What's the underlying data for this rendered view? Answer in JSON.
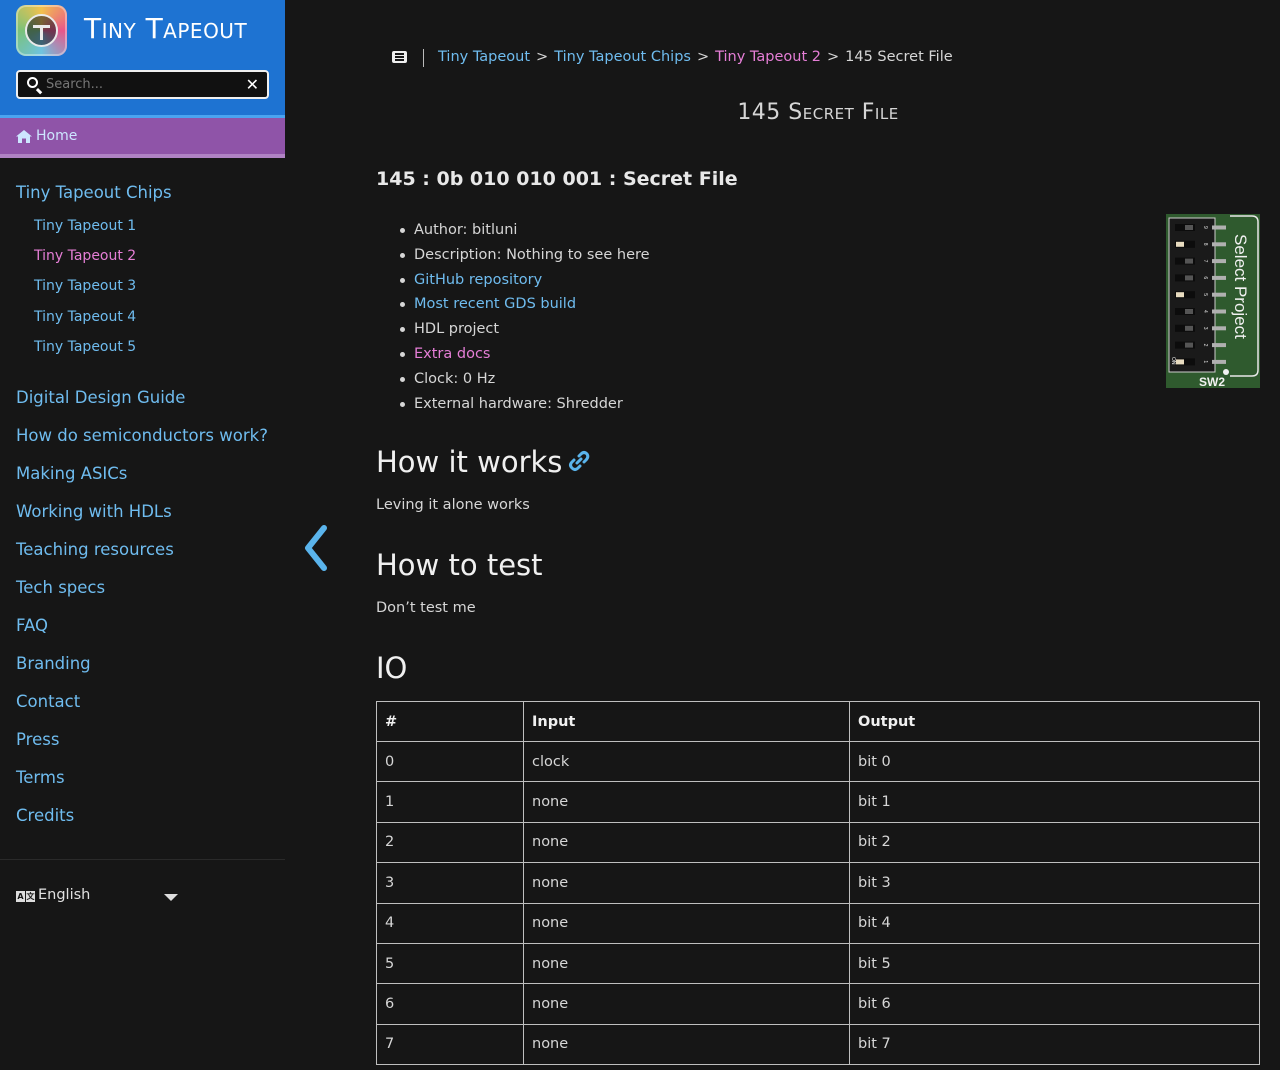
{
  "site": {
    "title": "Tiny Tapeout"
  },
  "search": {
    "placeholder": "Search..."
  },
  "sidebar": {
    "home": "Home",
    "chips_label": "Tiny Tapeout Chips",
    "chips": [
      "Tiny Tapeout 1",
      "Tiny Tapeout 2",
      "Tiny Tapeout 3",
      "Tiny Tapeout 4",
      "Tiny Tapeout 5"
    ],
    "active_chip": "Tiny Tapeout 2",
    "items": [
      "Digital Design Guide",
      "How do semiconductors work?",
      "Making ASICs",
      "Working with HDLs",
      "Teaching resources",
      "Tech specs",
      "FAQ",
      "Branding",
      "Contact",
      "Press",
      "Terms",
      "Credits"
    ],
    "language": "English",
    "language_icon_text": [
      "A",
      "文"
    ]
  },
  "breadcrumb": {
    "items": [
      "Tiny Tapeout",
      "Tiny Tapeout Chips",
      "Tiny Tapeout 2"
    ],
    "current": "145 Secret File",
    "separator": ">"
  },
  "page": {
    "title": "145 Secret File",
    "heading": "145 : 0b 010 010 001 : Secret File",
    "details": [
      "Author: bitluni",
      "Description: Nothing to see here",
      "GitHub repository",
      "Most recent GDS build",
      "HDL project",
      "Extra docs",
      "Clock: 0 Hz",
      "External hardware: Shredder"
    ],
    "how_it_works_title": "How it works",
    "how_it_works_text": "Leving it alone works",
    "how_to_test_title": "How to test",
    "how_to_test_text": "Don’t test me",
    "io_title": "IO"
  },
  "dip_switch": {
    "label": "Select Project",
    "switch_name": "SW2",
    "on_label": "ON",
    "numbers": [
      "9",
      "8",
      "7",
      "6",
      "5",
      "4",
      "3",
      "2",
      "1"
    ],
    "on_states": [
      false,
      true,
      false,
      false,
      true,
      false,
      false,
      false,
      true
    ]
  },
  "io_table": {
    "headers": [
      "#",
      "Input",
      "Output"
    ],
    "rows": [
      [
        "0",
        "clock",
        "bit 0"
      ],
      [
        "1",
        "none",
        "bit 1"
      ],
      [
        "2",
        "none",
        "bit 2"
      ],
      [
        "3",
        "none",
        "bit 3"
      ],
      [
        "4",
        "none",
        "bit 4"
      ],
      [
        "5",
        "none",
        "bit 5"
      ],
      [
        "6",
        "none",
        "bit 6"
      ],
      [
        "7",
        "none",
        "bit 7"
      ]
    ]
  },
  "colors": {
    "brand_blue": "#1e73d2",
    "home_purple": "#8f54a8",
    "link_blue": "#6fbcef",
    "link_pink": "#e57ed6",
    "background": "#161616",
    "pcb_green": "#2f5a2e"
  }
}
